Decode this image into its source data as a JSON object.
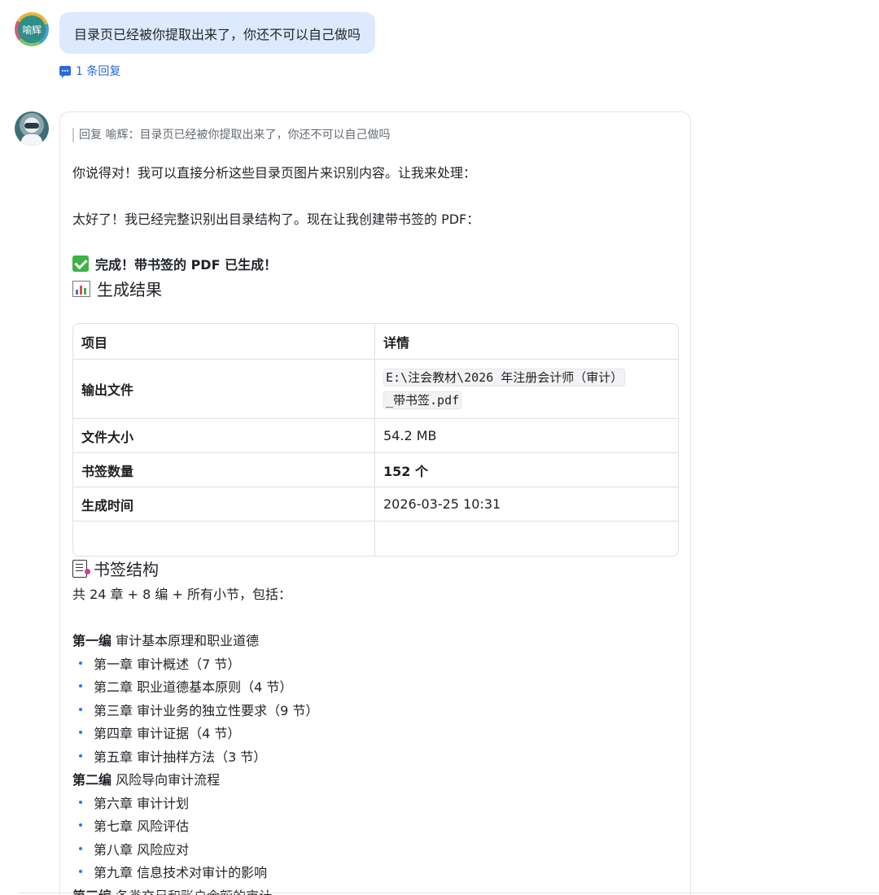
{
  "user_message": {
    "avatar_text": "喻辉",
    "text": "目录页已经被你提取出来了，你还不可以自己做吗",
    "reply_count": "1 条回复"
  },
  "bot_message": {
    "quote": "回复 喻辉：目录页已经被你提取出来了，你还不可以自己做吗",
    "para1": "你说得对！我可以直接分析这些目录页图片来识别内容。让我来处理：",
    "para2": "太好了！我已经完整识别出目录结构了。现在让我创建带书签的 PDF：",
    "done": "完成！带书签的 PDF 已生成！",
    "section_result": "生成结果",
    "table": {
      "headers": [
        "项目",
        "详情"
      ],
      "rows": [
        {
          "label": "输出文件",
          "value_line1": "E:\\注会教材\\2026 年注册会计师（审计）",
          "value_line2": "_带书签.pdf"
        },
        {
          "label": "文件大小",
          "value": "54.2 MB"
        },
        {
          "label": "书签数量",
          "value": "152 个"
        },
        {
          "label": "生成时间",
          "value": "2026-03-25 10:31"
        },
        {
          "label": "",
          "value": ""
        }
      ]
    },
    "section_bookmarks": "书签结构",
    "summary": "共 24 章 + 8 编 + 所有小节，包括：",
    "parts": [
      {
        "bold": "第一编",
        "title": " 审计基本原理和职业道德",
        "chapters": [
          "第一章 审计概述（7 节）",
          "第二章 职业道德基本原则（4 节）",
          "第三章 审计业务的独立性要求（9 节）",
          "第四章 审计证据（4 节）",
          "第五章 审计抽样方法（3 节）"
        ]
      },
      {
        "bold": "第二编",
        "title": " 风险导向审计流程",
        "chapters": [
          "第六章 审计计划",
          "第七章 风险评估",
          "第八章 风险应对",
          "第九章 信息技术对审计的影响"
        ]
      },
      {
        "bold": "第三编",
        "title": " 各类交易和账户余额的审计"
      }
    ]
  },
  "colors": {
    "user_bubble": "#dde9fd",
    "link": "#2a6ad9",
    "bullet": "#3370ff"
  }
}
